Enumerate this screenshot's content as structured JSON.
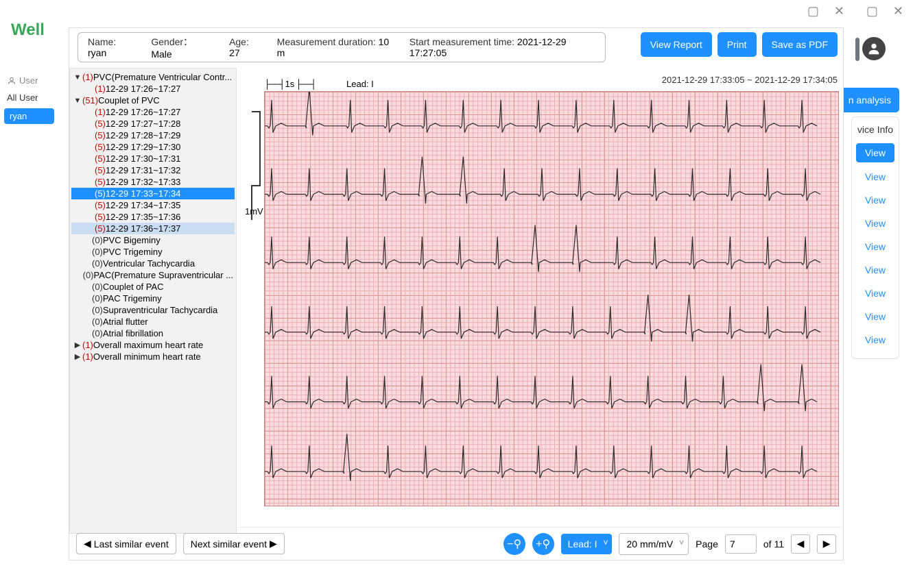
{
  "logo": "Well",
  "window": {
    "min": "▢",
    "close": "✕"
  },
  "sidebar": {
    "user_header": "User",
    "all_users": "All User",
    "selected_user": "ryan"
  },
  "right": {
    "analysis": "n analysis",
    "device_info": "vice Info",
    "view_label": "View",
    "view_count": 9
  },
  "patient": {
    "name_label": "Name:",
    "name": "ryan",
    "gender_label": "Gender：",
    "gender": "Male",
    "age_label": "Age:",
    "age": "27",
    "duration_label": "Measurement duration:",
    "duration": "10 m",
    "start_label": "Start measurement time:",
    "start": "2021-12-29 17:27:05"
  },
  "buttons": {
    "view_report": "View Report",
    "print": "Print",
    "save_pdf": "Save as PDF"
  },
  "tree": [
    {
      "level": 0,
      "count": "1",
      "label": "PVC(Premature Ventricular Contr...",
      "caret": "▼"
    },
    {
      "level": 1,
      "count": "1",
      "label": "12-29 17:26~17:27"
    },
    {
      "level": 0,
      "count": "51",
      "label": "Couplet of PVC",
      "caret": "▼"
    },
    {
      "level": 1,
      "count": "1",
      "label": "12-29 17:26~17:27"
    },
    {
      "level": 1,
      "count": "5",
      "label": "12-29 17:27~17:28"
    },
    {
      "level": 1,
      "count": "5",
      "label": "12-29 17:28~17:29"
    },
    {
      "level": 1,
      "count": "5",
      "label": "12-29 17:29~17:30"
    },
    {
      "level": 1,
      "count": "5",
      "label": "12-29 17:30~17:31"
    },
    {
      "level": 1,
      "count": "5",
      "label": "12-29 17:31~17:32"
    },
    {
      "level": 1,
      "count": "5",
      "label": "12-29 17:32~17:33"
    },
    {
      "level": 1,
      "count": "5",
      "label": "12-29 17:33~17:34",
      "selected": true
    },
    {
      "level": 1,
      "count": "5",
      "label": "12-29 17:34~17:35"
    },
    {
      "level": 1,
      "count": "5",
      "label": "12-29 17:35~17:36"
    },
    {
      "level": 1,
      "count": "5",
      "label": "12-29 17:36~17:37",
      "hover": true
    },
    {
      "level": 0,
      "count": "0",
      "label": "PVC Bigeminy"
    },
    {
      "level": 0,
      "count": "0",
      "label": "PVC Trigeminy"
    },
    {
      "level": 0,
      "count": "0",
      "label": "Ventricular Tachycardia"
    },
    {
      "level": 0,
      "count": "0",
      "label": "PAC(Premature Supraventricular ..."
    },
    {
      "level": 0,
      "count": "0",
      "label": "Couplet of PAC"
    },
    {
      "level": 0,
      "count": "0",
      "label": "PAC Trigeminy"
    },
    {
      "level": 0,
      "count": "0",
      "label": "Supraventricular Tachycardia"
    },
    {
      "level": 0,
      "count": "0",
      "label": "Atrial flutter"
    },
    {
      "level": 0,
      "count": "0",
      "label": "Atrial fibrillation"
    },
    {
      "level": 0,
      "count": "1",
      "label": "Overall maximum heart rate",
      "caret": "▶"
    },
    {
      "level": 0,
      "count": "1",
      "label": "Overall minimum heart rate",
      "caret": "▶"
    }
  ],
  "ecg": {
    "timestamp": "2021-12-29 17:33:05 ~ 2021-12-29 17:34:05",
    "timebase": "1s",
    "lead": "Lead: I",
    "amplitude": "1mV"
  },
  "footer": {
    "last": "Last similar event",
    "next": "Next similar event",
    "lead_select": "Lead: I",
    "gain_select": "20 mm/mV",
    "page_label": "Page",
    "page_current": "7",
    "page_total_prefix": "of ",
    "page_total": "11"
  }
}
